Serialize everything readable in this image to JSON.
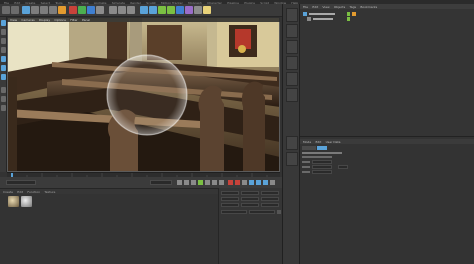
{
  "colors": {
    "ui_bg": "#333333",
    "accent_orange": "#e39b2f",
    "accent_blue": "#5aa3d9",
    "record_red": "#c8423a",
    "viewport_border": "#5b5b5b"
  },
  "menubar": {
    "items": [
      "File",
      "Edit",
      "Create",
      "Select",
      "Tools",
      "Mesh",
      "Snap",
      "Animate",
      "Simulate",
      "Render",
      "Sculpt",
      "Motion Tracker",
      "MoGraph",
      "Character",
      "Pipeline",
      "Plugins",
      "Script",
      "Window",
      "Help"
    ]
  },
  "viewport": {
    "menu": [
      "View",
      "Cameras",
      "Display",
      "Options",
      "Filter",
      "Panel"
    ]
  },
  "materials": {
    "menu": [
      "Create",
      "Edit",
      "Function",
      "Texture"
    ]
  },
  "object_manager": {
    "menu": [
      "File",
      "Edit",
      "View",
      "Objects",
      "Tags",
      "Bookmarks"
    ]
  },
  "attribute_manager": {
    "menu": [
      "Mode",
      "Edit",
      "User Data"
    ]
  },
  "icons": {
    "toolbar": [
      "undo-icon",
      "redo-icon",
      "live-selection-icon",
      "move-icon",
      "scale-icon",
      "rotate-icon",
      "recent-tool-icon",
      "x-axis-icon",
      "y-axis-icon",
      "z-axis-icon",
      "coordinate-system-icon",
      "render-view-icon",
      "render-picture-viewer-icon",
      "edit-render-settings-icon",
      "cube-icon",
      "pen-icon",
      "subdivision-icon",
      "array-icon",
      "boole-icon",
      "floor-icon",
      "camera-icon",
      "light-icon"
    ],
    "transport": [
      "go-to-start-icon",
      "previous-key-icon",
      "previous-frame-icon",
      "play-icon",
      "next-frame-icon",
      "next-key-icon",
      "go-to-end-icon",
      "record-icon",
      "autokey-icon",
      "keyframe-selection-icon"
    ]
  }
}
